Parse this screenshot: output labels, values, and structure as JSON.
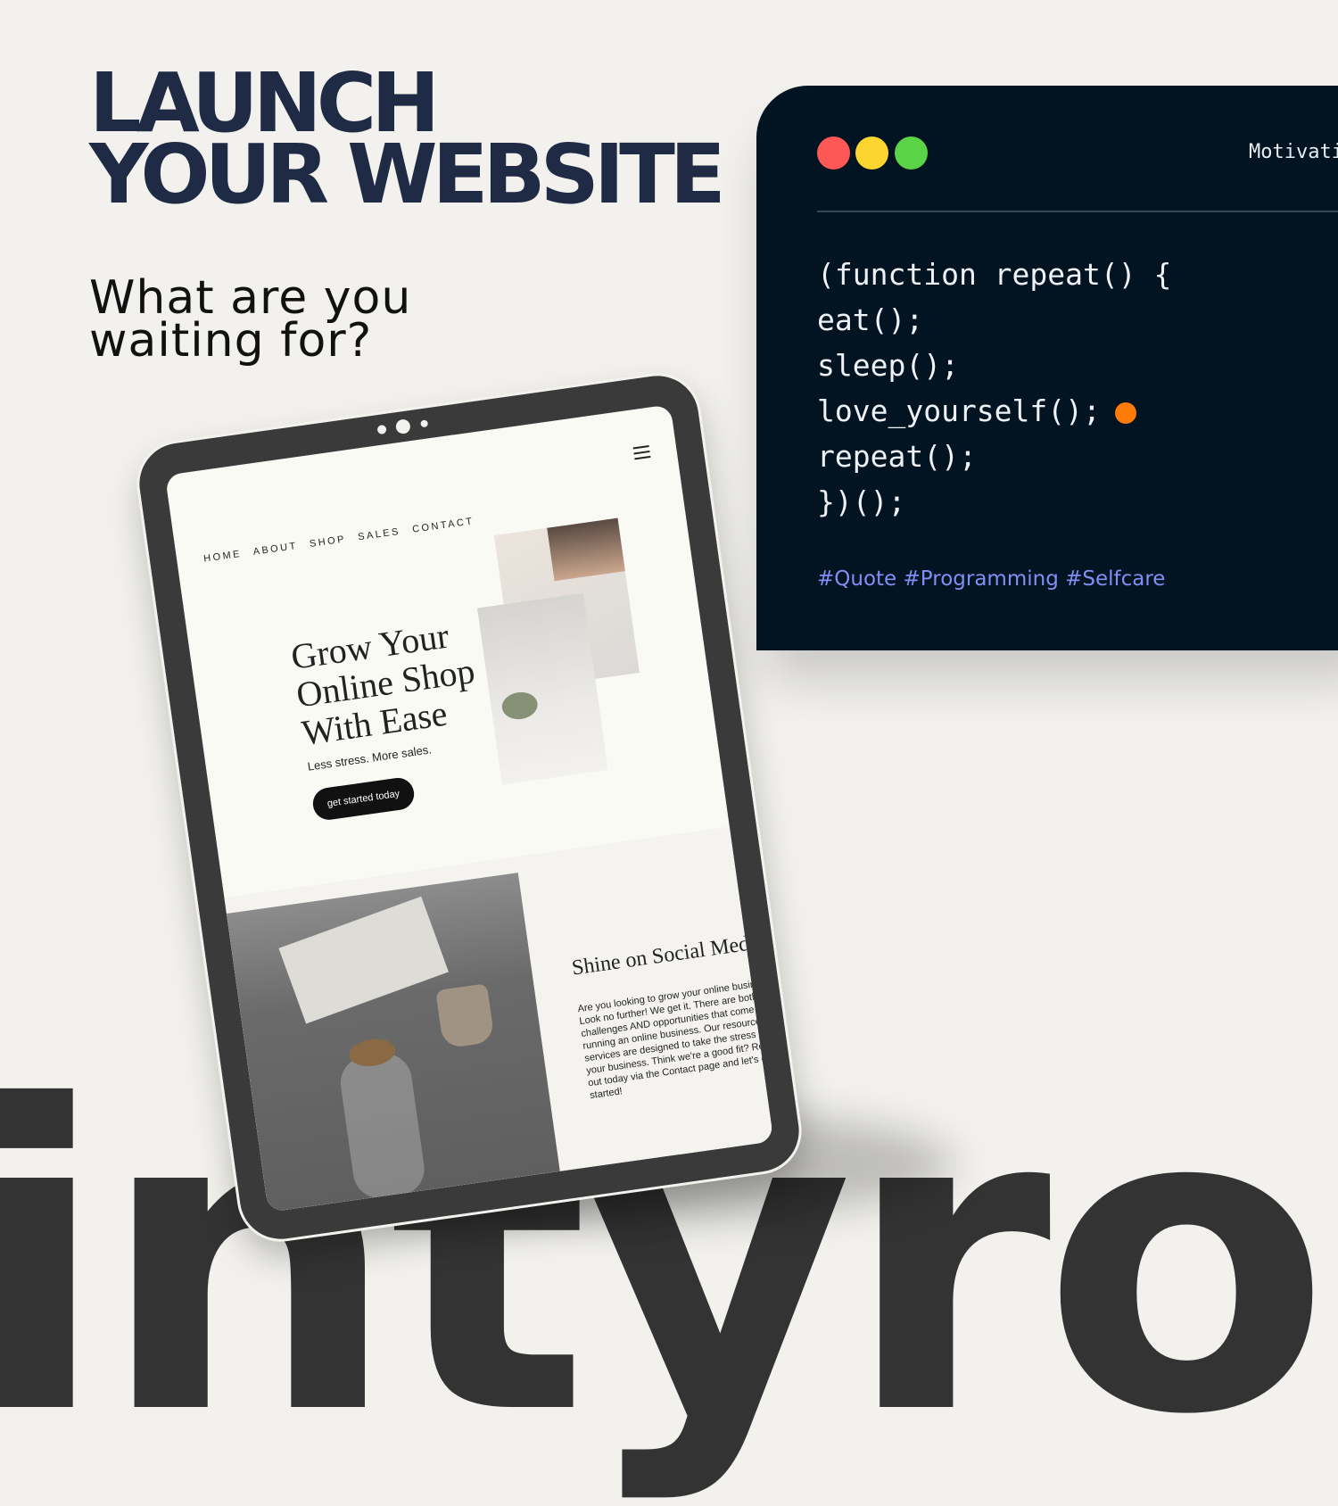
{
  "headline": {
    "line1": "LAUNCH",
    "line2": "YOUR WEBSITE"
  },
  "subhead": {
    "line1": "What are you",
    "line2": "waiting for?"
  },
  "code_window": {
    "title": "Motivati",
    "lines": [
      "(function repeat() {",
      "eat();",
      "sleep();",
      "love_yourself();",
      "repeat();",
      "})();"
    ],
    "hashtags": "#Quote #Programming #Selfcare",
    "dot_colors": [
      "#fd5756",
      "#fdd531",
      "#5ad446"
    ],
    "marker_color": "#fd7b06"
  },
  "tablet": {
    "nav": [
      "HOME",
      "ABOUT",
      "SHOP",
      "SALES",
      "CONTACT"
    ],
    "menu_icon": "hamburger-icon",
    "hero": {
      "title_lines": [
        "Grow Your",
        "Online Shop",
        "With Ease"
      ],
      "subtitle": "Less stress. More sales.",
      "cta": "get started today"
    },
    "social": {
      "title": "Shine on Social Media",
      "body": "Are you looking to grow your online business? Look no further! We get it. There are both challenges AND opportunities that come with running an online business. Our resources and services are designed to take the stress out of your business. Think we're a good fit? Reach out today via the Contact page and let's get started!"
    }
  },
  "watermark": "intyro",
  "colors": {
    "background": "#f2f1ed",
    "headline": "#1f2a44",
    "code_bg": "#021322",
    "hashtag": "#7f8ff5"
  }
}
